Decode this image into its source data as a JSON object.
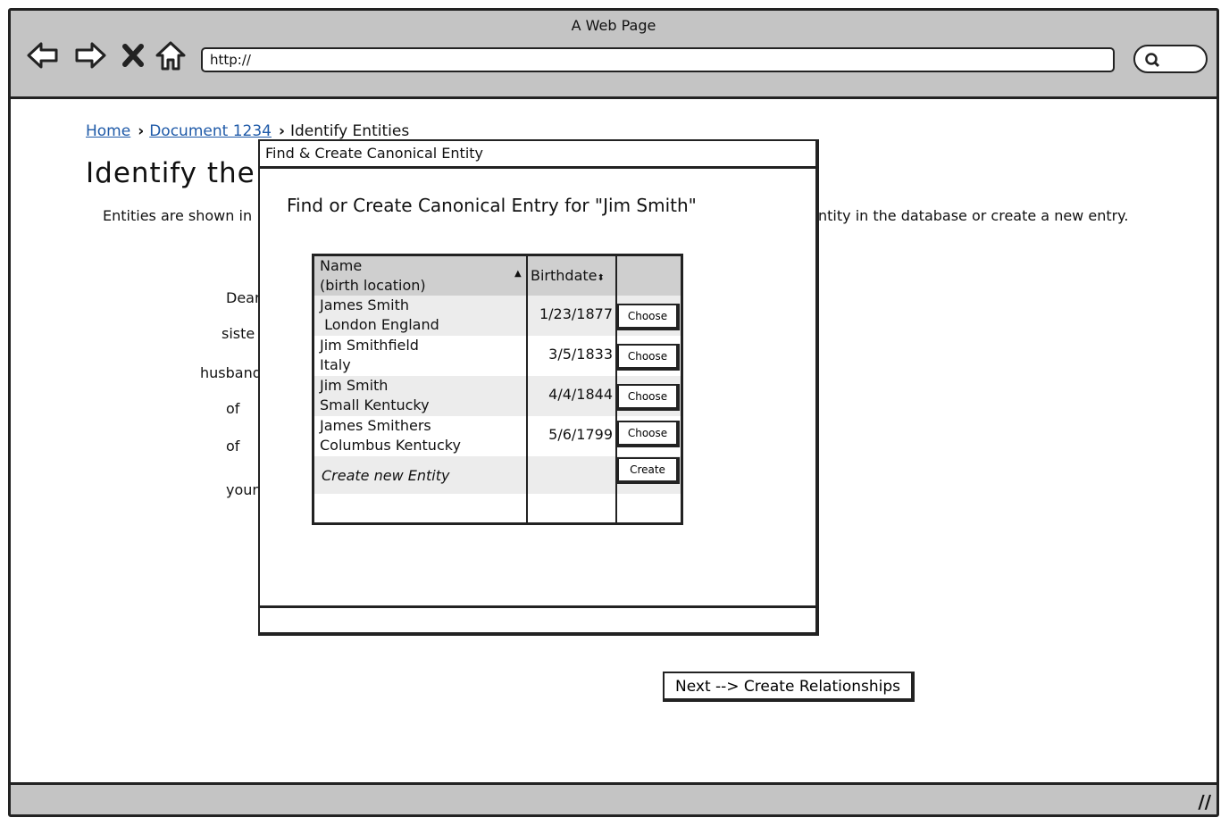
{
  "window": {
    "title": "A Web Page",
    "url": "http://"
  },
  "breadcrumb": {
    "home": "Home",
    "document": "Document 1234",
    "current": "Identify Entities"
  },
  "page": {
    "title": "Identify the E",
    "intro_left": "Entities are shown in",
    "intro_right": "ntity in the database or create a new entry.",
    "document_words": [
      "Dear",
      "siste",
      "husband",
      "of",
      "of",
      "your"
    ],
    "next_button": "Next --> Create Relationships"
  },
  "modal": {
    "title": "Find & Create Canonical Entity",
    "heading": "Find or Create Canonical Entry for \"Jim Smith\"",
    "table": {
      "columns": [
        "Name",
        "(birth location)",
        "Birthdate"
      ],
      "rows": [
        {
          "name": "James Smith",
          "location": " London England",
          "birthdate": "1/23/1877",
          "action": "Choose"
        },
        {
          "name": "Jim Smithfield",
          "location": "Italy",
          "birthdate": "3/5/1833",
          "action": "Choose"
        },
        {
          "name": "Jim Smith",
          "location": "Small Kentucky",
          "birthdate": "4/4/1844",
          "action": "Choose"
        },
        {
          "name": "James Smithers",
          "location": "Columbus Kentucky",
          "birthdate": "5/6/1799",
          "action": "Choose"
        }
      ],
      "create_label": "Create new Entity",
      "create_button": "Create"
    }
  },
  "icons": {
    "back": "back-arrow-icon",
    "forward": "forward-arrow-icon",
    "stop": "close-icon",
    "home": "home-icon",
    "search": "search-icon",
    "resize": "resize-grip-icon"
  }
}
